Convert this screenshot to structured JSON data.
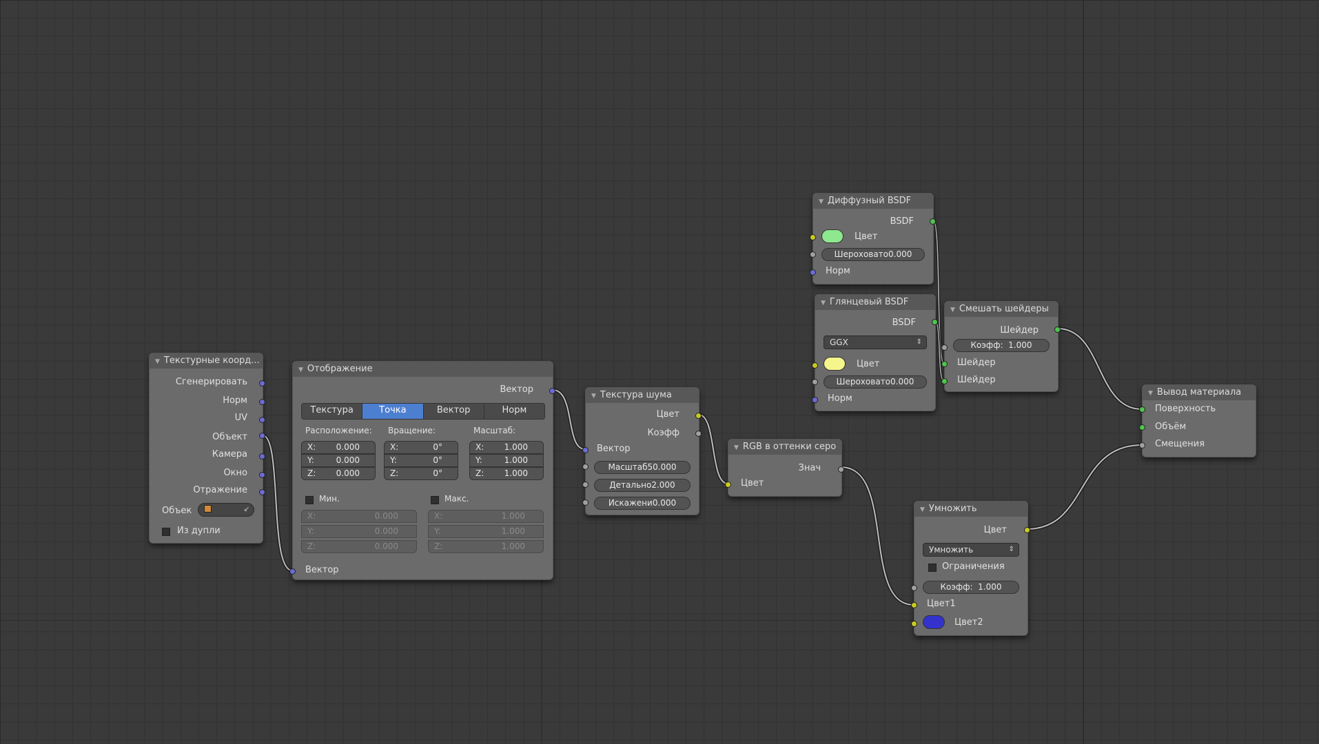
{
  "colors": {
    "background": "#3a3a3a",
    "node_body": "#6b6b6b",
    "node_header": "#585858",
    "socket_vector": "#6b6bd6",
    "socket_color": "#c9c923",
    "socket_shader": "#4ec44e",
    "socket_value": "#a0a0a0",
    "diffuse_color": "#8ee88e",
    "glossy_color": "#f5f58c",
    "color2": "#3333cc",
    "active_tab": "#4d7fd0"
  },
  "texcoord": {
    "title": "Текстурные коорд...",
    "outputs": [
      "Сгенерировать",
      "Норм",
      "UV",
      "Объект",
      "Камера",
      "Окно",
      "Отражение"
    ],
    "object_label": "Объек",
    "object_icon": "cube-icon",
    "from_instancer": "Из дупли"
  },
  "mapping": {
    "title": "Отображение",
    "out_vector": "Вектор",
    "tabs": [
      "Текстура",
      "Точка",
      "Вектор",
      "Норм"
    ],
    "active_tab": "Точка",
    "loc_label": "Расположение:",
    "rot_label": "Вращение:",
    "scale_label": "Масштаб:",
    "loc": [
      "X:",
      "0.000",
      "Y:",
      "0.000",
      "Z:",
      "0.000"
    ],
    "rot": [
      "X:",
      "0°",
      "Y:",
      "0°",
      "Z:",
      "0°"
    ],
    "scale": [
      "X:",
      "1.000",
      "Y:",
      "1.000",
      "Z:",
      "1.000"
    ],
    "min_label": "Мин.",
    "max_label": "Макс.",
    "min": [
      "X:",
      "0.000",
      "Y:",
      "0.000",
      "Z:",
      "0.000"
    ],
    "max": [
      "X:",
      "1.000",
      "Y:",
      "1.000",
      "Z:",
      "1.000"
    ],
    "in_vector": "Вектор"
  },
  "noise": {
    "title": "Текстура шума",
    "out_color": "Цвет",
    "out_fac": "Коэфф",
    "in_vector": "Вектор",
    "scale": "Масштаб50.000",
    "detail": "Детально2.000",
    "distortion": "Искажени0.000"
  },
  "rgb2bw": {
    "title": "RGB в оттенки серо",
    "out_val": "Знач",
    "in_color": "Цвет"
  },
  "diffuse": {
    "title": "Диффузный BSDF",
    "out": "BSDF",
    "color": "Цвет",
    "roughness": "Шероховато0.000",
    "normal": "Норм"
  },
  "glossy": {
    "title": "Глянцевый BSDF",
    "out": "BSDF",
    "distribution": "GGX",
    "color": "Цвет",
    "roughness": "Шероховато0.000",
    "normal": "Норм"
  },
  "mix": {
    "title": "Смешать шейдеры",
    "out": "Шейдер",
    "fac_label": "Коэфф:",
    "fac_value": "1.000",
    "in1": "Шейдер",
    "in2": "Шейдер"
  },
  "output": {
    "title": "Вывод материала",
    "surface": "Поверхность",
    "volume": "Объём",
    "displacement": "Смещения"
  },
  "multiply": {
    "title": "Умножить",
    "out": "Цвет",
    "blend": "Умножить",
    "clamp": "Ограничения",
    "fac_label": "Коэфф:",
    "fac_value": "1.000",
    "color1": "Цвет1",
    "color2": "Цвет2"
  }
}
